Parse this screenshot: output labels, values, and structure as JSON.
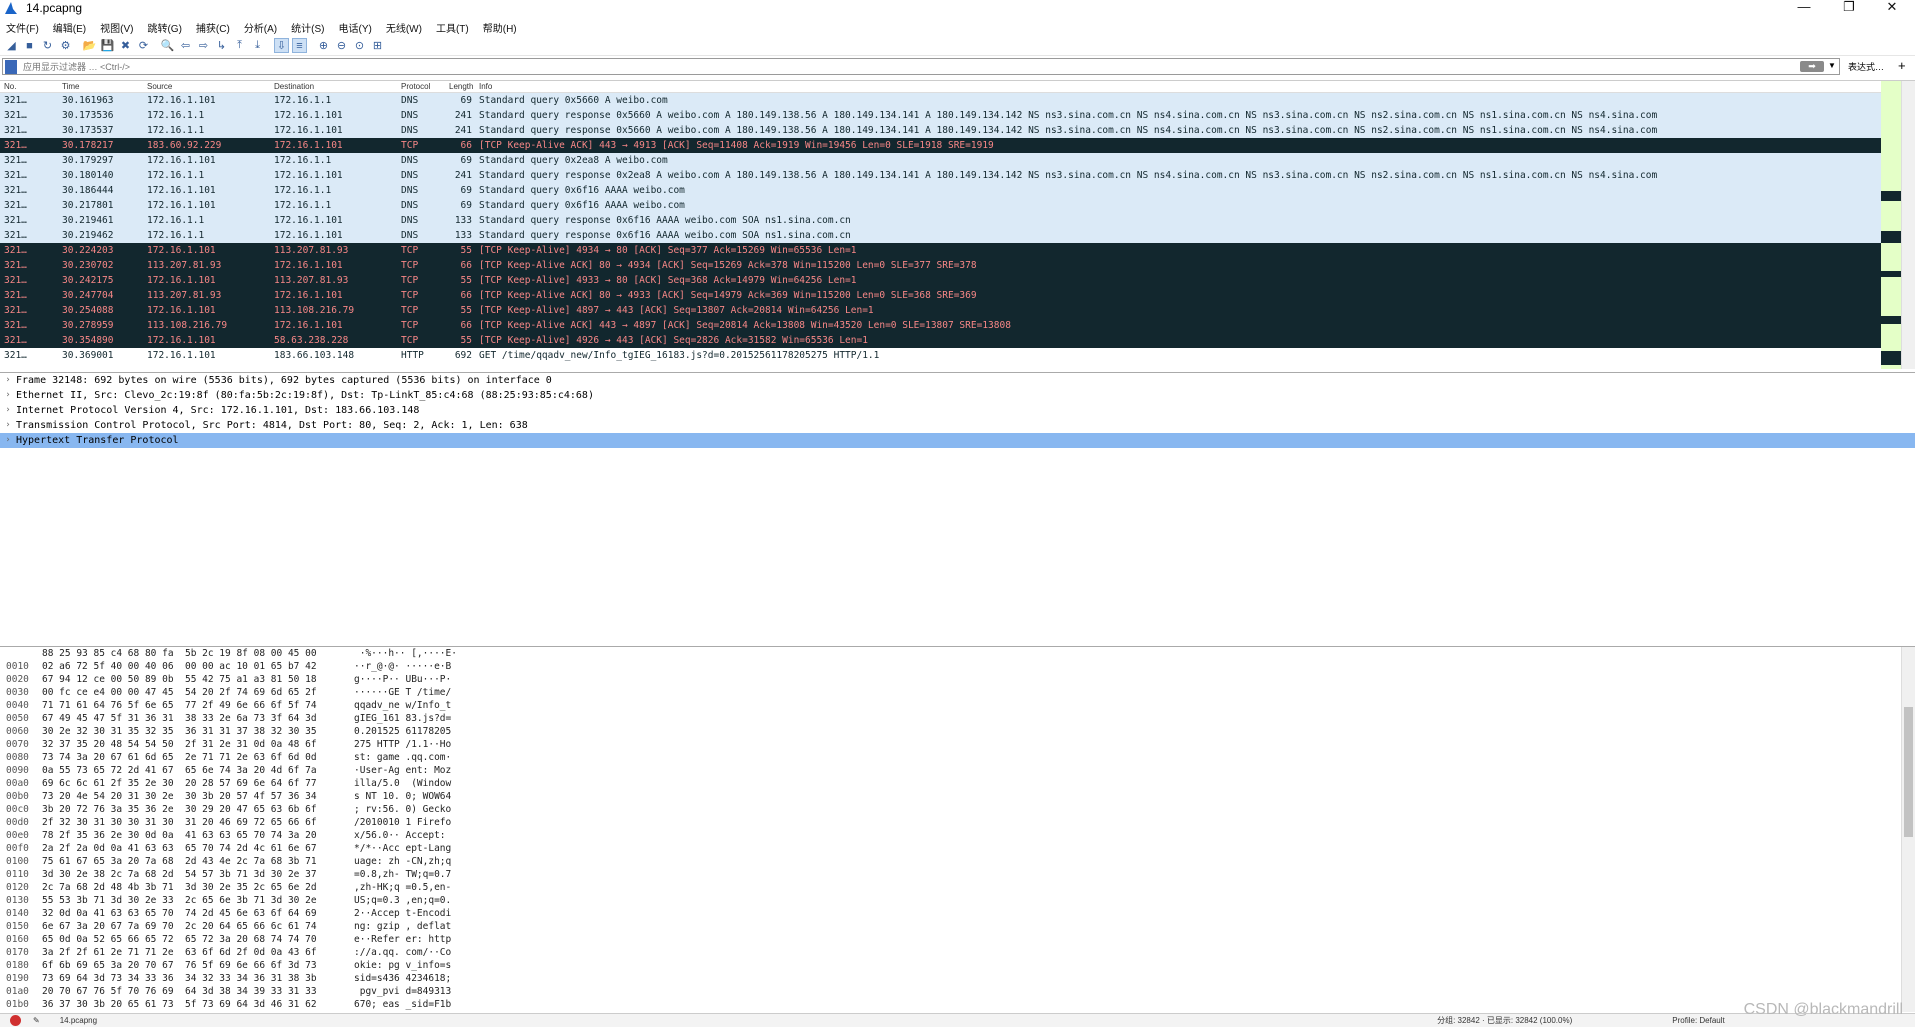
{
  "window": {
    "title": "14.pcapng",
    "minimize": "—",
    "restore": "❐",
    "close": "✕"
  },
  "menu": [
    "文件(F)",
    "编辑(E)",
    "视图(V)",
    "跳转(G)",
    "捕获(C)",
    "分析(A)",
    "统计(S)",
    "电话(Y)",
    "无线(W)",
    "工具(T)",
    "帮助(H)"
  ],
  "toolbar": {
    "icons": [
      "shark-fin-start-icon",
      "stop-square-icon",
      "restart-icon",
      "options-gear-icon",
      "open-folder-icon",
      "save-file-icon",
      "close-file-icon",
      "reload-icon",
      "find-icon",
      "go-back-icon",
      "go-forward-icon",
      "go-to-packet-icon",
      "first-packet-icon",
      "last-packet-icon",
      "autoscroll-icon",
      "colorize-icon",
      "zoom-in-icon",
      "zoom-out-icon",
      "normal-size-icon",
      "resize-columns-icon"
    ]
  },
  "filter": {
    "placeholder": "应用显示过滤器 … <Ctrl-/>",
    "expression_label": "表达式…",
    "plus": "+"
  },
  "columns": [
    "No.",
    "Time",
    "Source",
    "Destination",
    "Protocol",
    "Length",
    "Info"
  ],
  "packets": [
    {
      "no": "321…",
      "time": "30.161963",
      "src": "172.16.1.101",
      "dst": "172.16.1.1",
      "proto": "DNS",
      "len": "69",
      "info": "Standard query 0x5660 A weibo.com",
      "cls": "dns"
    },
    {
      "no": "321…",
      "time": "30.173536",
      "src": "172.16.1.1",
      "dst": "172.16.1.101",
      "proto": "DNS",
      "len": "241",
      "info": "Standard query response 0x5660 A weibo.com A 180.149.138.56 A 180.149.134.141 A 180.149.134.142 NS ns3.sina.com.cn NS ns4.sina.com.cn NS ns3.sina.com.cn NS ns2.sina.com.cn NS ns1.sina.com.cn NS ns4.sina.com",
      "cls": "dns"
    },
    {
      "no": "321…",
      "time": "30.173537",
      "src": "172.16.1.1",
      "dst": "172.16.1.101",
      "proto": "DNS",
      "len": "241",
      "info": "Standard query response 0x5660 A weibo.com A 180.149.138.56 A 180.149.134.141 A 180.149.134.142 NS ns3.sina.com.cn NS ns4.sina.com.cn NS ns3.sina.com.cn NS ns2.sina.com.cn NS ns1.sina.com.cn NS ns4.sina.com",
      "cls": "dns"
    },
    {
      "no": "321…",
      "time": "30.178217",
      "src": "183.60.92.229",
      "dst": "172.16.1.101",
      "proto": "TCP",
      "len": "66",
      "info": "[TCP Keep-Alive ACK] 443 → 4913 [ACK] Seq=11408 Ack=1919 Win=19456 Len=0 SLE=1918 SRE=1919",
      "cls": "ka"
    },
    {
      "no": "321…",
      "time": "30.179297",
      "src": "172.16.1.101",
      "dst": "172.16.1.1",
      "proto": "DNS",
      "len": "69",
      "info": "Standard query 0x2ea8 A weibo.com",
      "cls": "dns"
    },
    {
      "no": "321…",
      "time": "30.180140",
      "src": "172.16.1.1",
      "dst": "172.16.1.101",
      "proto": "DNS",
      "len": "241",
      "info": "Standard query response 0x2ea8 A weibo.com A 180.149.138.56 A 180.149.134.141 A 180.149.134.142 NS ns3.sina.com.cn NS ns4.sina.com.cn NS ns3.sina.com.cn NS ns2.sina.com.cn NS ns1.sina.com.cn NS ns4.sina.com",
      "cls": "dns"
    },
    {
      "no": "321…",
      "time": "30.186444",
      "src": "172.16.1.101",
      "dst": "172.16.1.1",
      "proto": "DNS",
      "len": "69",
      "info": "Standard query 0x6f16 AAAA weibo.com",
      "cls": "dns"
    },
    {
      "no": "321…",
      "time": "30.217801",
      "src": "172.16.1.101",
      "dst": "172.16.1.1",
      "proto": "DNS",
      "len": "69",
      "info": "Standard query 0x6f16 AAAA weibo.com",
      "cls": "dns"
    },
    {
      "no": "321…",
      "time": "30.219461",
      "src": "172.16.1.1",
      "dst": "172.16.1.101",
      "proto": "DNS",
      "len": "133",
      "info": "Standard query response 0x6f16 AAAA weibo.com SOA ns1.sina.com.cn",
      "cls": "dns"
    },
    {
      "no": "321…",
      "time": "30.219462",
      "src": "172.16.1.1",
      "dst": "172.16.1.101",
      "proto": "DNS",
      "len": "133",
      "info": "Standard query response 0x6f16 AAAA weibo.com SOA ns1.sina.com.cn",
      "cls": "dns"
    },
    {
      "no": "321…",
      "time": "30.224203",
      "src": "172.16.1.101",
      "dst": "113.207.81.93",
      "proto": "TCP",
      "len": "55",
      "info": "[TCP Keep-Alive] 4934 → 80 [ACK] Seq=377 Ack=15269 Win=65536 Len=1",
      "cls": "ka"
    },
    {
      "no": "321…",
      "time": "30.230702",
      "src": "113.207.81.93",
      "dst": "172.16.1.101",
      "proto": "TCP",
      "len": "66",
      "info": "[TCP Keep-Alive ACK] 80 → 4934 [ACK] Seq=15269 Ack=378 Win=115200 Len=0 SLE=377 SRE=378",
      "cls": "ka"
    },
    {
      "no": "321…",
      "time": "30.242175",
      "src": "172.16.1.101",
      "dst": "113.207.81.93",
      "proto": "TCP",
      "len": "55",
      "info": "[TCP Keep-Alive] 4933 → 80 [ACK] Seq=368 Ack=14979 Win=64256 Len=1",
      "cls": "ka"
    },
    {
      "no": "321…",
      "time": "30.247704",
      "src": "113.207.81.93",
      "dst": "172.16.1.101",
      "proto": "TCP",
      "len": "66",
      "info": "[TCP Keep-Alive ACK] 80 → 4933 [ACK] Seq=14979 Ack=369 Win=115200 Len=0 SLE=368 SRE=369",
      "cls": "ka"
    },
    {
      "no": "321…",
      "time": "30.254088",
      "src": "172.16.1.101",
      "dst": "113.108.216.79",
      "proto": "TCP",
      "len": "55",
      "info": "[TCP Keep-Alive] 4897 → 443 [ACK] Seq=13807 Ack=20814 Win=64256 Len=1",
      "cls": "ka"
    },
    {
      "no": "321…",
      "time": "30.278959",
      "src": "113.108.216.79",
      "dst": "172.16.1.101",
      "proto": "TCP",
      "len": "66",
      "info": "[TCP Keep-Alive ACK] 443 → 4897 [ACK] Seq=20814 Ack=13808 Win=43520 Len=0 SLE=13807 SRE=13808",
      "cls": "ka"
    },
    {
      "no": "321…",
      "time": "30.354890",
      "src": "172.16.1.101",
      "dst": "58.63.238.228",
      "proto": "TCP",
      "len": "55",
      "info": "[TCP Keep-Alive] 4926 → 443 [ACK] Seq=2826 Ack=31582 Win=65536 Len=1",
      "cls": "ka"
    },
    {
      "no": "321…",
      "time": "30.369001",
      "src": "172.16.1.101",
      "dst": "183.66.103.148",
      "proto": "HTTP",
      "len": "692",
      "info": "GET /time/qqadv_new/Info_tgIEG_16183.js?d=0.20152561178205275 HTTP/1.1",
      "cls": "plain"
    }
  ],
  "details": [
    {
      "text": "Frame 32148: 692 bytes on wire (5536 bits), 692 bytes captured (5536 bits) on interface 0",
      "selected": false
    },
    {
      "text": "Ethernet II, Src: Clevo_2c:19:8f (80:fa:5b:2c:19:8f), Dst: Tp-LinkT_85:c4:68 (88:25:93:85:c4:68)",
      "selected": false
    },
    {
      "text": "Internet Protocol Version 4, Src: 172.16.1.101, Dst: 183.66.103.148",
      "selected": false
    },
    {
      "text": "Transmission Control Protocol, Src Port: 4814, Dst Port: 80, Seq: 2, Ack: 1, Len: 638",
      "selected": false
    },
    {
      "text": "Hypertext Transfer Protocol",
      "selected": true
    }
  ],
  "bytes": [
    {
      "off": "",
      "hex": "88 25 93 85 c4 68 80 fa  5b 2c 19 8f 08 00 45 00",
      "asc": " ·%···h·· [,····E·"
    },
    {
      "off": "0010",
      "hex": "02 a6 72 5f 40 00 40 06  00 00 ac 10 01 65 b7 42",
      "asc": "··r_@·@· ·····e·B"
    },
    {
      "off": "0020",
      "hex": "67 94 12 ce 00 50 89 0b  55 42 75 a1 a3 81 50 18",
      "asc": "g····P·· UBu···P·"
    },
    {
      "off": "0030",
      "hex": "00 fc ce e4 00 00 47 45  54 20 2f 74 69 6d 65 2f",
      "asc": "······GE T /time/"
    },
    {
      "off": "0040",
      "hex": "71 71 61 64 76 5f 6e 65  77 2f 49 6e 66 6f 5f 74",
      "asc": "qqadv_ne w/Info_t"
    },
    {
      "off": "0050",
      "hex": "67 49 45 47 5f 31 36 31  38 33 2e 6a 73 3f 64 3d",
      "asc": "gIEG_161 83.js?d="
    },
    {
      "off": "0060",
      "hex": "30 2e 32 30 31 35 32 35  36 31 31 37 38 32 30 35",
      "asc": "0.201525 61178205"
    },
    {
      "off": "0070",
      "hex": "32 37 35 20 48 54 54 50  2f 31 2e 31 0d 0a 48 6f",
      "asc": "275 HTTP /1.1··Ho"
    },
    {
      "off": "0080",
      "hex": "73 74 3a 20 67 61 6d 65  2e 71 71 2e 63 6f 6d 0d",
      "asc": "st: game .qq.com·"
    },
    {
      "off": "0090",
      "hex": "0a 55 73 65 72 2d 41 67  65 6e 74 3a 20 4d 6f 7a",
      "asc": "·User-Ag ent: Moz"
    },
    {
      "off": "00a0",
      "hex": "69 6c 6c 61 2f 35 2e 30  20 28 57 69 6e 64 6f 77",
      "asc": "illa/5.0  (Window"
    },
    {
      "off": "00b0",
      "hex": "73 20 4e 54 20 31 30 2e  30 3b 20 57 4f 57 36 34",
      "asc": "s NT 10. 0; WOW64"
    },
    {
      "off": "00c0",
      "hex": "3b 20 72 76 3a 35 36 2e  30 29 20 47 65 63 6b 6f",
      "asc": "; rv:56. 0) Gecko"
    },
    {
      "off": "00d0",
      "hex": "2f 32 30 31 30 30 31 30  31 20 46 69 72 65 66 6f",
      "asc": "/2010010 1 Firefo"
    },
    {
      "off": "00e0",
      "hex": "78 2f 35 36 2e 30 0d 0a  41 63 63 65 70 74 3a 20",
      "asc": "x/56.0·· Accept: "
    },
    {
      "off": "00f0",
      "hex": "2a 2f 2a 0d 0a 41 63 63  65 70 74 2d 4c 61 6e 67",
      "asc": "*/*··Acc ept-Lang"
    },
    {
      "off": "0100",
      "hex": "75 61 67 65 3a 20 7a 68  2d 43 4e 2c 7a 68 3b 71",
      "asc": "uage: zh -CN,zh;q"
    },
    {
      "off": "0110",
      "hex": "3d 30 2e 38 2c 7a 68 2d  54 57 3b 71 3d 30 2e 37",
      "asc": "=0.8,zh- TW;q=0.7"
    },
    {
      "off": "0120",
      "hex": "2c 7a 68 2d 48 4b 3b 71  3d 30 2e 35 2c 65 6e 2d",
      "asc": ",zh-HK;q =0.5,en-"
    },
    {
      "off": "0130",
      "hex": "55 53 3b 71 3d 30 2e 33  2c 65 6e 3b 71 3d 30 2e",
      "asc": "US;q=0.3 ,en;q=0."
    },
    {
      "off": "0140",
      "hex": "32 0d 0a 41 63 63 65 70  74 2d 45 6e 63 6f 64 69",
      "asc": "2··Accep t-Encodi"
    },
    {
      "off": "0150",
      "hex": "6e 67 3a 20 67 7a 69 70  2c 20 64 65 66 6c 61 74",
      "asc": "ng: gzip , deflat"
    },
    {
      "off": "0160",
      "hex": "65 0d 0a 52 65 66 65 72  65 72 3a 20 68 74 74 70",
      "asc": "e··Refer er: http"
    },
    {
      "off": "0170",
      "hex": "3a 2f 2f 61 2e 71 71 2e  63 6f 6d 2f 0d 0a 43 6f",
      "asc": "://a.qq. com/··Co"
    },
    {
      "off": "0180",
      "hex": "6f 6b 69 65 3a 20 70 67  76 5f 69 6e 66 6f 3d 73",
      "asc": "okie: pg v_info=s"
    },
    {
      "off": "0190",
      "hex": "73 69 64 3d 73 34 33 36  34 32 33 34 36 31 38 3b",
      "asc": "sid=s436 4234618;"
    },
    {
      "off": "01a0",
      "hex": "20 70 67 76 5f 70 76 69  64 3d 38 34 39 33 31 33",
      "asc": " pgv_pvi d=849313"
    },
    {
      "off": "01b0",
      "hex": "36 37 30 3b 20 65 61 73  5f 73 69 64 3d 46 31 62",
      "asc": "670; eas _sid=F1b"
    }
  ],
  "status": {
    "file": "14.pcapng",
    "counts": "分组: 32842 · 已显示: 32842 (100.0%)",
    "profile": "Profile: Default"
  },
  "watermark": "CSDN @blackmandrill",
  "colors": {
    "dns_bg": "#dbeaf7",
    "ka_bg": "#12272e",
    "ka_fg": "#f78787",
    "selected_detail": "#88b7f0"
  }
}
